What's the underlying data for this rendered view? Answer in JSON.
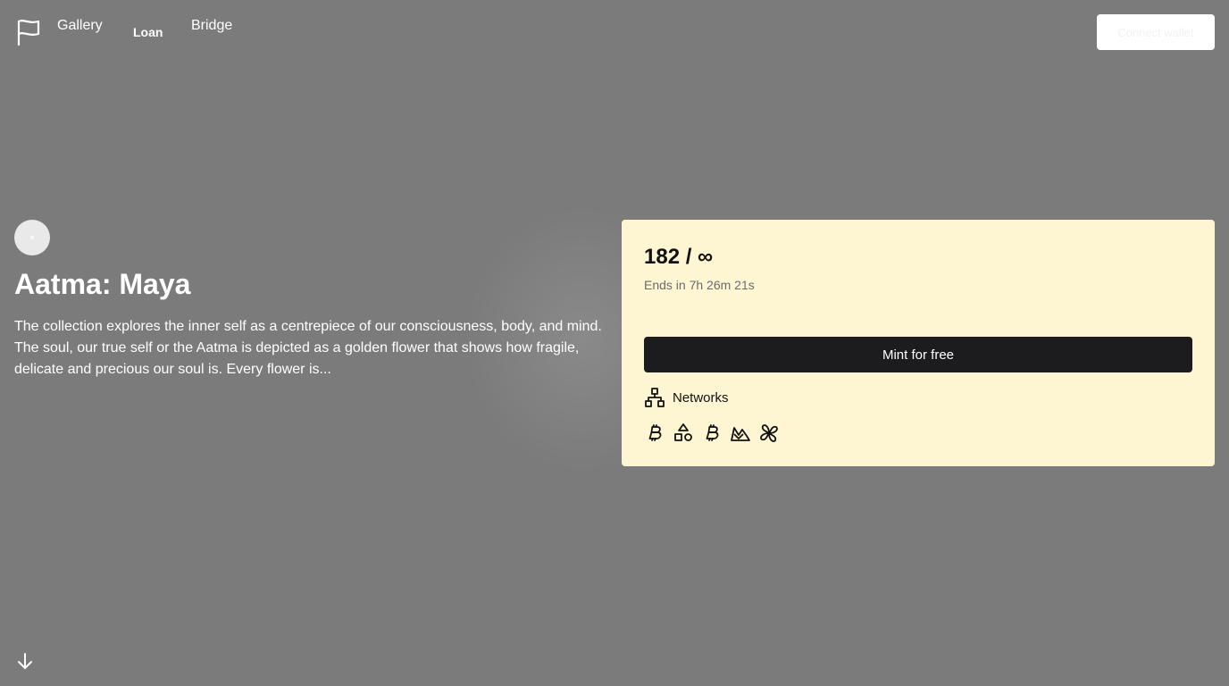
{
  "nav": {
    "links": [
      {
        "label": "Gallery"
      },
      {
        "label": "Loan"
      },
      {
        "label": "Bridge"
      }
    ],
    "connect_wallet_label": "Connect wallet"
  },
  "hero": {
    "title": "Aatma: Maya",
    "description": "The collection explores the inner self as a centrepiece of our consciousness, body, and mind. The soul, our true self or the Aatma is depicted as a golden flower that shows how fragile, delicate and precious our soul is. Every flower is..."
  },
  "mint": {
    "count": "182 / ∞",
    "ends": "Ends in 7h 26m 21s",
    "button_label": "Mint for free",
    "networks_label": "Networks",
    "networks": [
      "bitcoin-icon",
      "shapes-icon",
      "bitcoin-icon",
      "mountain-icon",
      "pinwheel-icon"
    ]
  },
  "colors": {
    "background": "#7b7b7b",
    "card_background": "#fef6d2",
    "button_dark": "#1c1c1e"
  }
}
